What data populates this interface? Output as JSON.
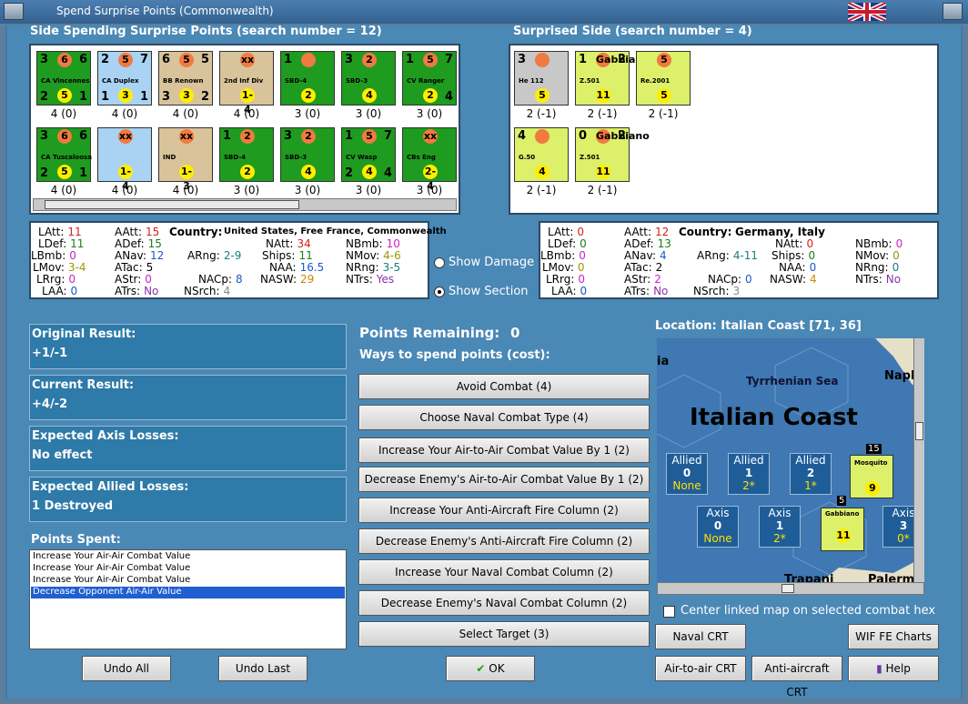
{
  "window": {
    "title": "Spend Surprise Points (Commonwealth)"
  },
  "colors": {
    "green": "#1f9b1f",
    "blue": "#aad3f3",
    "tan": "#d8c39b",
    "light": "#dcf06a",
    "grey": "#c8c8c8",
    "bg": "#4a88b6"
  },
  "spending": {
    "title": "Side Spending Surprise Points (search number = 12)",
    "row1": [
      {
        "name": "CA Vincennes",
        "tl": "3",
        "top": "6",
        "tr": "6",
        "bl": "2",
        "bot": "5",
        "br": "1",
        "cap": "4 (0)",
        "color": "green"
      },
      {
        "name": "CA Duplex",
        "tl": "2",
        "top": "5",
        "tr": "7",
        "bl": "1",
        "bot": "3",
        "br": "1",
        "cap": "4 (0)",
        "color": "blue"
      },
      {
        "name": "BB Renown",
        "tl": "6",
        "top": "5",
        "tr": "5",
        "bl": "3",
        "bot": "3",
        "br": "2",
        "cap": "4 (0)",
        "color": "tan"
      },
      {
        "name": "2nd Inf Div",
        "tl": "",
        "top": "xx",
        "tr": "",
        "bl": "",
        "bot": "1-4",
        "br": "",
        "cap": "4 (0)",
        "color": "tan"
      },
      {
        "name": "SBD-4",
        "tl": "1",
        "top": "",
        "tr": "",
        "bl": "",
        "bot": "2",
        "br": "",
        "cap": "3 (0)",
        "color": "green"
      },
      {
        "name": "SBD-3",
        "tl": "3",
        "top": "2",
        "tr": "",
        "bl": "",
        "bot": "4",
        "br": "",
        "cap": "3 (0)",
        "color": "green"
      },
      {
        "name": "CV Ranger",
        "tl": "1",
        "top": "5",
        "tr": "7",
        "bl": "",
        "bot": "2",
        "br": "4",
        "cap": "3 (0)",
        "color": "green"
      }
    ],
    "row2": [
      {
        "name": "CA Tuscaloosa",
        "tl": "3",
        "top": "6",
        "tr": "6",
        "bl": "2",
        "bot": "5",
        "br": "1",
        "cap": "4 (0)",
        "color": "green"
      },
      {
        "name": "",
        "tl": "",
        "top": "xx",
        "tr": "",
        "bl": "",
        "bot": "1-4",
        "br": "",
        "cap": "4 (0)",
        "color": "blue"
      },
      {
        "name": "IND",
        "tl": "",
        "top": "xx",
        "tr": "",
        "bl": "",
        "bot": "1-3",
        "br": "",
        "cap": "4 (0)",
        "color": "tan"
      },
      {
        "name": "SBD-4",
        "tl": "1",
        "top": "2",
        "tr": "",
        "bl": "",
        "bot": "2",
        "br": "",
        "cap": "3 (0)",
        "color": "green"
      },
      {
        "name": "SBD-3",
        "tl": "3",
        "top": "2",
        "tr": "",
        "bl": "",
        "bot": "4",
        "br": "",
        "cap": "3 (0)",
        "color": "green"
      },
      {
        "name": "CV Wasp",
        "tl": "1",
        "top": "5",
        "tr": "7",
        "bl": "2",
        "bot": "4",
        "br": "4",
        "cap": "3 (0)",
        "color": "green"
      },
      {
        "name": "CBs Eng",
        "tl": "",
        "top": "xx",
        "tr": "",
        "bl": "",
        "bot": "2-4",
        "br": "",
        "cap": "3 (0)",
        "color": "green"
      }
    ]
  },
  "surprised": {
    "title": "Surprised Side (search number = 4)",
    "row1": [
      {
        "name": "He 112",
        "tl": "3",
        "top": "",
        "tr": "",
        "bl": "",
        "bot": "5",
        "br": "",
        "cap": "2 (-1)",
        "color": "grey"
      },
      {
        "name": "Z.501",
        "tl": "1",
        "top": "Gabbiano",
        "tr": "2",
        "bl": "",
        "bot": "11",
        "br": "",
        "cap": "2 (-1)",
        "color": "light"
      },
      {
        "name": "Re.2001",
        "tl": "",
        "top": "5",
        "tr": "",
        "bl": "",
        "bot": "5",
        "br": "",
        "cap": "2 (-1)",
        "color": "light"
      }
    ],
    "row2": [
      {
        "name": "G.50",
        "tl": "4",
        "top": "",
        "tr": "",
        "bl": "",
        "bot": "4",
        "br": "",
        "cap": "2 (-1)",
        "color": "light"
      },
      {
        "name": "Z.501",
        "tl": "0",
        "top": "Gabbiano",
        "tr": "2",
        "bl": "",
        "bot": "11",
        "br": "",
        "cap": "2 (-1)",
        "color": "light"
      }
    ]
  },
  "leftStats": {
    "country": "United States, Free France, Commonwealth",
    "items": [
      {
        "k": "LAtt:",
        "v": "11",
        "c": "#d42020"
      },
      {
        "k": "AAtt:",
        "v": "15",
        "c": "#d42020"
      },
      {
        "k": "LDef:",
        "v": "11",
        "c": "#178017"
      },
      {
        "k": "ADef:",
        "v": "15",
        "c": "#178017"
      },
      {
        "k": "LBmb:",
        "v": "0",
        "c": "#cc22cc"
      },
      {
        "k": "ANav:",
        "v": "12",
        "c": "#2255cc"
      },
      {
        "k": "LMov:",
        "v": "3-4",
        "c": "#999900"
      },
      {
        "k": "ATac:",
        "v": "5",
        "c": "#000"
      },
      {
        "k": "LRrg:",
        "v": "0",
        "c": "#cc22cc"
      },
      {
        "k": "AStr:",
        "v": "0",
        "c": "#cc22cc"
      },
      {
        "k": "LAA:",
        "v": "0",
        "c": "#2255cc"
      },
      {
        "k": "ATrs:",
        "v": "No",
        "c": "#8833aa"
      },
      {
        "k": "ARng:",
        "v": "2-9",
        "c": "#178080"
      },
      {
        "k": "NACp:",
        "v": "8",
        "c": "#2255cc"
      },
      {
        "k": "NSrch:",
        "v": "4",
        "c": "#888"
      },
      {
        "k": "NAtt:",
        "v": "34",
        "c": "#d42020"
      },
      {
        "k": "Ships:",
        "v": "11",
        "c": "#178017"
      },
      {
        "k": "NAA:",
        "v": "16.5",
        "c": "#2255cc"
      },
      {
        "k": "NASW:",
        "v": "29",
        "c": "#d08800"
      },
      {
        "k": "NBmb:",
        "v": "10",
        "c": "#cc22cc"
      },
      {
        "k": "NMov:",
        "v": "4-6",
        "c": "#999900"
      },
      {
        "k": "NRng:",
        "v": "3-5",
        "c": "#178080"
      },
      {
        "k": "NTrs:",
        "v": "Yes",
        "c": "#8833aa"
      }
    ]
  },
  "rightStats": {
    "country": "Germany, Italy",
    "items": [
      {
        "k": "LAtt:",
        "v": "0",
        "c": "#d42020"
      },
      {
        "k": "AAtt:",
        "v": "12",
        "c": "#d42020"
      },
      {
        "k": "LDef:",
        "v": "0",
        "c": "#178017"
      },
      {
        "k": "ADef:",
        "v": "13",
        "c": "#178017"
      },
      {
        "k": "LBmb:",
        "v": "0",
        "c": "#cc22cc"
      },
      {
        "k": "ANav:",
        "v": "4",
        "c": "#2255cc"
      },
      {
        "k": "LMov:",
        "v": "0",
        "c": "#999900"
      },
      {
        "k": "ATac:",
        "v": "2",
        "c": "#000"
      },
      {
        "k": "LRrg:",
        "v": "0",
        "c": "#cc22cc"
      },
      {
        "k": "AStr:",
        "v": "2",
        "c": "#cc22cc"
      },
      {
        "k": "LAA:",
        "v": "0",
        "c": "#2255cc"
      },
      {
        "k": "ATrs:",
        "v": "No",
        "c": "#8833aa"
      },
      {
        "k": "ARng:",
        "v": "4-11",
        "c": "#178080"
      },
      {
        "k": "NACp:",
        "v": "0",
        "c": "#2255cc"
      },
      {
        "k": "NSrch:",
        "v": "3",
        "c": "#888"
      },
      {
        "k": "NAtt:",
        "v": "0",
        "c": "#d42020"
      },
      {
        "k": "Ships:",
        "v": "0",
        "c": "#178017"
      },
      {
        "k": "NAA:",
        "v": "0",
        "c": "#2255cc"
      },
      {
        "k": "NASW:",
        "v": "4",
        "c": "#d08800"
      },
      {
        "k": "NBmb:",
        "v": "0",
        "c": "#cc22cc"
      },
      {
        "k": "NMov:",
        "v": "0",
        "c": "#999900"
      },
      {
        "k": "NRng:",
        "v": "0",
        "c": "#178080"
      },
      {
        "k": "NTrs:",
        "v": "No",
        "c": "#8833aa"
      }
    ]
  },
  "options": {
    "damage": "Show Damage",
    "section": "Show Section"
  },
  "results": {
    "orig_t": "Original Result:",
    "orig_v": "+1/-1",
    "cur_t": "Current Result:",
    "cur_v": "+4/-2",
    "axis_t": "Expected Axis Losses:",
    "axis_v": "No effect",
    "allied_t": "Expected Allied Losses:",
    "allied_v": "1 Destroyed"
  },
  "spent": {
    "title": "Points Spent:",
    "items": [
      "Increase Your Air-Air Combat Value",
      "Increase Your Air-Air Combat Value",
      "Increase Your Air-Air Combat Value",
      "Decrease Opponent Air-Air Value"
    ]
  },
  "points": {
    "remaining_label": "Points Remaining:",
    "remaining": "0",
    "ways": "Ways to spend points (cost):"
  },
  "ways": [
    "Avoid Combat (4)",
    "Choose Naval Combat Type (4)",
    "Increase Your Air-to-Air Combat Value By 1 (2)",
    "Decrease Enemy's Air-to-Air Combat Value By 1 (2)",
    "Increase Your Anti-Aircraft Fire Column (2)",
    "Decrease Enemy's Anti-Aircraft Fire Column (2)",
    "Increase Your Naval Combat Column (2)",
    "Decrease Enemy's Naval Combat Column (2)",
    "Select Target (3)"
  ],
  "buttons": {
    "undo_all": "Undo All",
    "undo_last": "Undo Last",
    "ok": "OK",
    "naval": "Naval CRT",
    "wif": "WIF FE Charts",
    "air": "Air-to-air CRT",
    "aa": "Anti-aircraft CRT",
    "help": "Help"
  },
  "map": {
    "location": "Location: Italian Coast [71, 36]",
    "title": "Italian Coast",
    "sea": "Tyrrhenian Sea",
    "n1": "Napl",
    "n2": "ia",
    "n3": "Trapani",
    "n4": "Palerm",
    "allied": [
      {
        "l": "Allied",
        "n": "0",
        "s": "None"
      },
      {
        "l": "Allied",
        "n": "1",
        "s": "2*"
      },
      {
        "l": "Allied",
        "n": "2",
        "s": "1*"
      }
    ],
    "axis": [
      {
        "l": "Axis",
        "n": "0",
        "s": "None"
      },
      {
        "l": "Axis",
        "n": "1",
        "s": "2*"
      },
      {
        "l": "Axis",
        "n": "3",
        "s": "0*"
      }
    ],
    "stack1": "15",
    "stack2": "5",
    "mos": "Mosquito",
    "mos_n": "9",
    "gab": "Gabbiano",
    "gab_n": "11"
  },
  "center_link": "Center linked map on selected combat hex"
}
